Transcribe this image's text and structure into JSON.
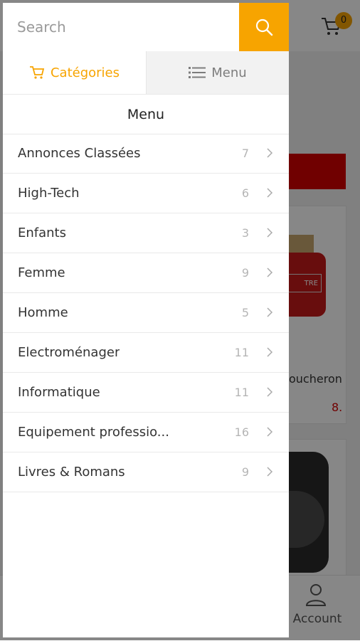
{
  "search": {
    "placeholder": "Search"
  },
  "tabs": {
    "categories": "Catégories",
    "menu": "Menu"
  },
  "menu_title": "Menu",
  "categories": [
    {
      "name": "Annonces Classées",
      "count": "7"
    },
    {
      "name": "High-Tech",
      "count": "6"
    },
    {
      "name": "Enfants",
      "count": "3"
    },
    {
      "name": "Femme",
      "count": "9"
    },
    {
      "name": "Homme",
      "count": "5"
    },
    {
      "name": "Electroménager",
      "count": "11"
    },
    {
      "name": "Informatique",
      "count": "11"
    },
    {
      "name": "Equipement professio...",
      "count": "16"
    },
    {
      "name": "Livres & Romans",
      "count": "9"
    }
  ],
  "background": {
    "cart_count": "0",
    "product_name_fragment": "oucheron",
    "product_price_fragment": "8.",
    "perfume_label_fragment": "TRE",
    "account_label": "Account"
  },
  "colors": {
    "accent": "#f7a400",
    "price": "#d40000"
  },
  "icons": {
    "search": "search-icon",
    "cart": "cart-icon",
    "list": "list-icon",
    "chevron": "chevron-right-icon",
    "account": "account-icon"
  }
}
